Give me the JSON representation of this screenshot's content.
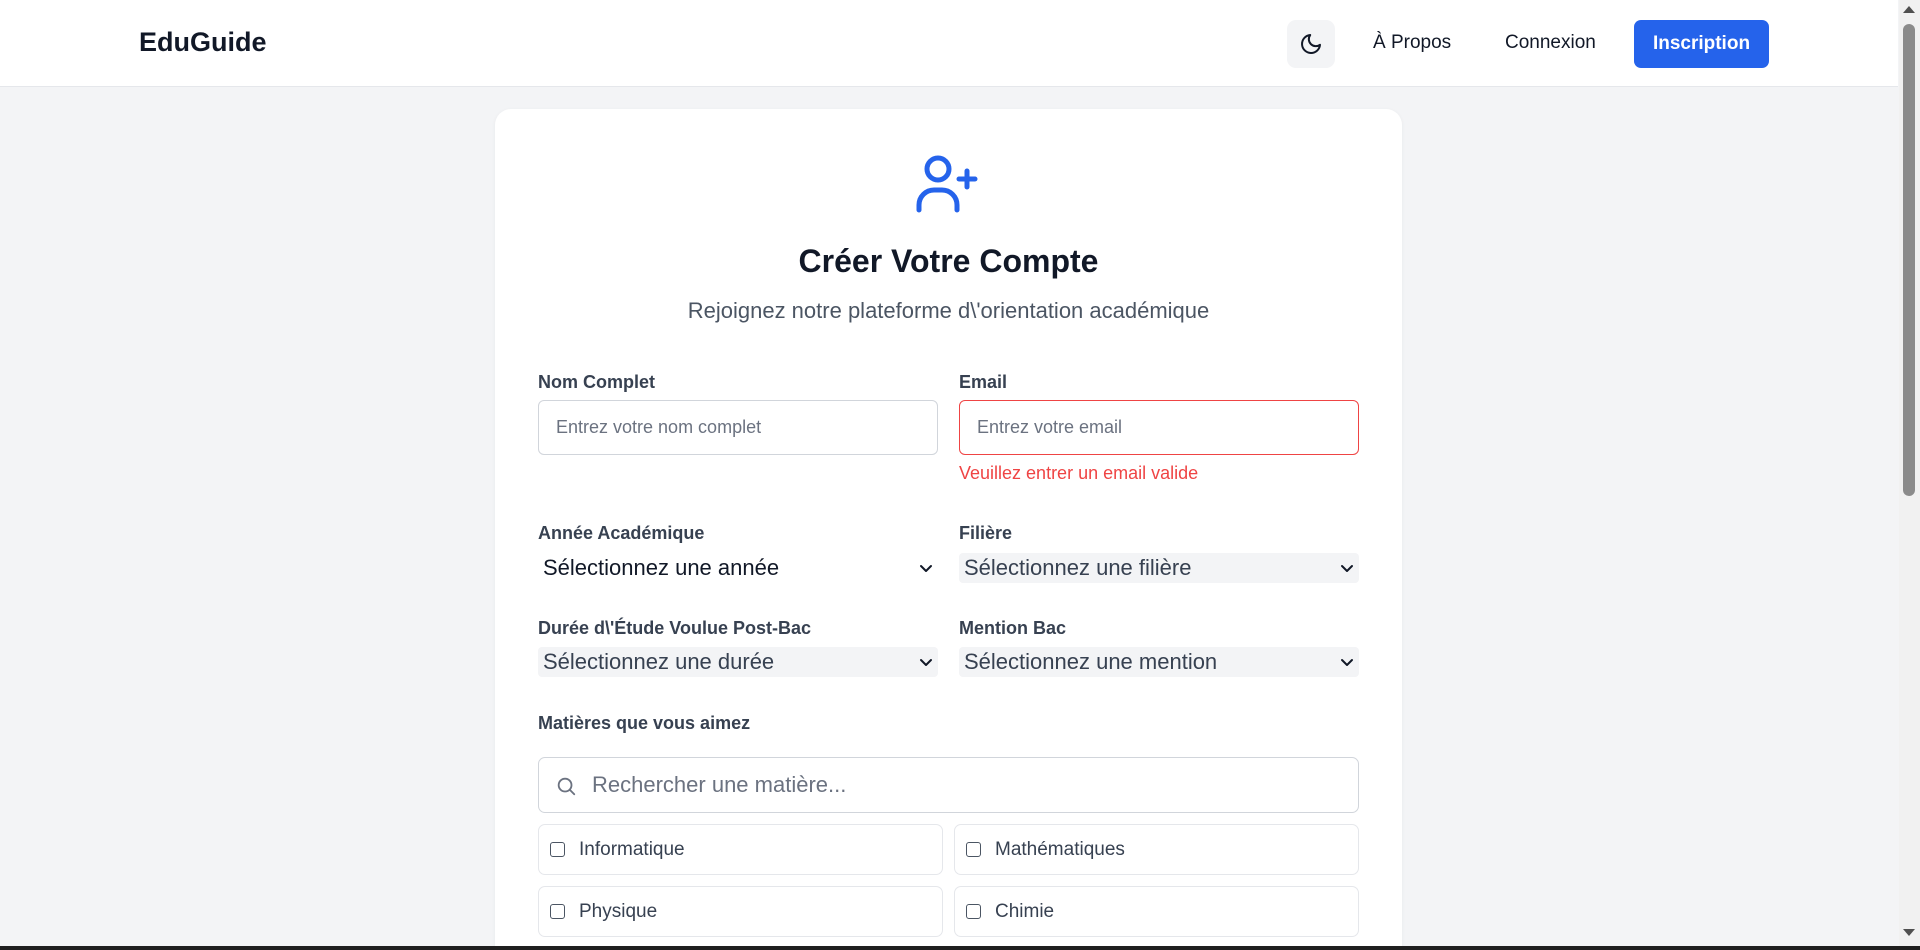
{
  "navbar": {
    "brand": "EduGuide",
    "theme_toggle_icon": "moon-icon",
    "links": {
      "about": "À Propos",
      "login": "Connexion"
    },
    "signup_label": "Inscription"
  },
  "form": {
    "header_icon": "user-plus-icon",
    "title": "Créer Votre Compte",
    "subtitle": "Rejoignez notre plateforme d\\'orientation académique",
    "full_name": {
      "label": "Nom Complet",
      "placeholder": "Entrez votre nom complet",
      "value": ""
    },
    "email": {
      "label": "Email",
      "placeholder": "Entrez votre email",
      "value": "",
      "error": "Veuillez entrer un email valide"
    },
    "academic_year": {
      "label": "Année Académique",
      "selected": "Sélectionnez une année"
    },
    "field": {
      "label": "Filière",
      "selected": "Sélectionnez une filière"
    },
    "study_duration": {
      "label": "Durée d\\'Étude Voulue Post-Bac",
      "selected": "Sélectionnez une durée"
    },
    "bac_mention": {
      "label": "Mention Bac",
      "selected": "Sélectionnez une mention"
    },
    "subjects": {
      "label": "Matières que vous aimez",
      "search_placeholder": "Rechercher une matière...",
      "items": [
        {
          "label": "Informatique",
          "checked": false
        },
        {
          "label": "Mathématiques",
          "checked": false
        },
        {
          "label": "Physique",
          "checked": false
        },
        {
          "label": "Chimie",
          "checked": false
        }
      ]
    }
  },
  "colors": {
    "accent": "#2563eb",
    "error": "#ef4444",
    "background": "#f3f4f6",
    "card": "#ffffff",
    "text": "#111827"
  }
}
